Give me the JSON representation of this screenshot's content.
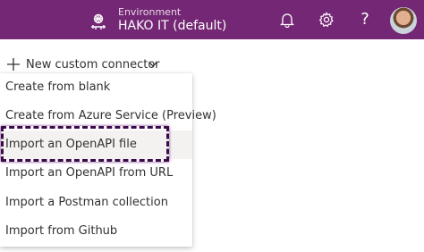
{
  "header": {
    "environment_caption": "Environment",
    "environment_name": "HAKO IT (default)",
    "help_glyph": "?",
    "icons": [
      "environment-icon",
      "bell-icon",
      "gear-icon",
      "help-icon",
      "avatar"
    ],
    "bar_color": "#742774"
  },
  "toolbar": {
    "new_label": "New custom connector",
    "icons": [
      "plus-icon",
      "chevron-down-icon"
    ]
  },
  "menu": {
    "items": [
      {
        "label": "Create from blank"
      },
      {
        "label": "Create from Azure Service (Preview)"
      },
      {
        "label": "Import an OpenAPI file"
      },
      {
        "label": "Import an OpenAPI from URL"
      },
      {
        "label": "Import a Postman collection"
      },
      {
        "label": "Import from Github"
      }
    ],
    "highlighted_item": "Import an OpenAPI file",
    "highlight_color": "#3a0a4a"
  }
}
